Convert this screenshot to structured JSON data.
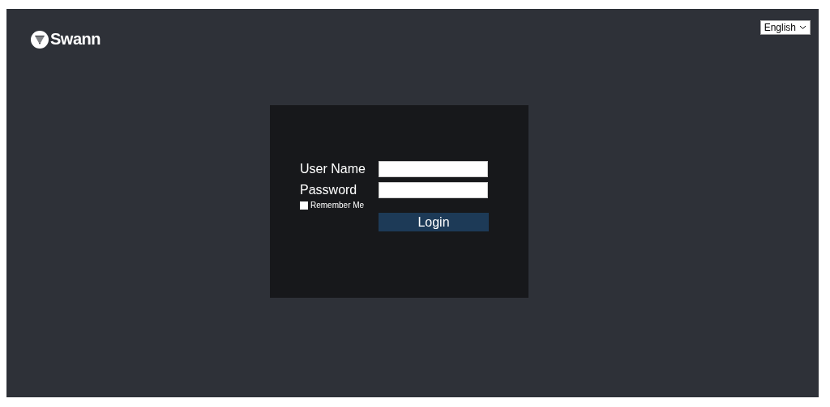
{
  "header": {
    "logo_text": "Swann",
    "language": "English"
  },
  "login_form": {
    "username_label": "User Name",
    "password_label": "Password",
    "remember_me": {
      "label": "Remember Me",
      "checked": false
    },
    "login_button": "Login"
  }
}
